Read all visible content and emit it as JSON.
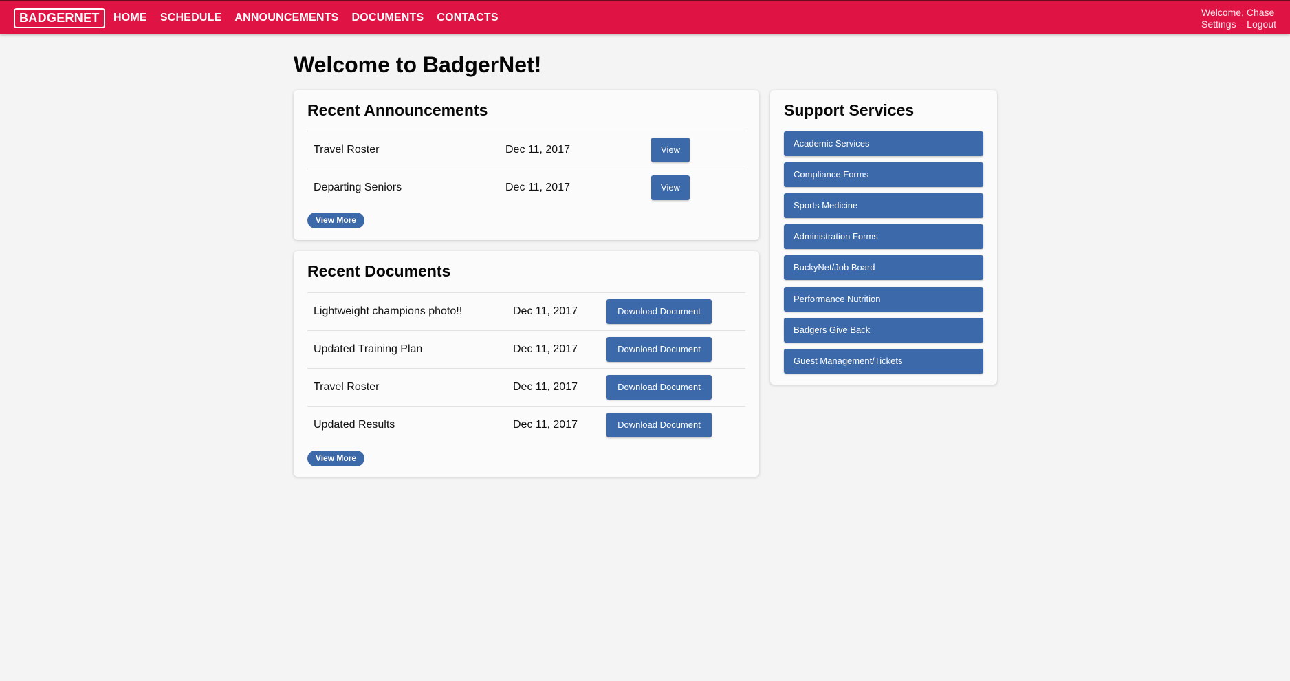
{
  "header": {
    "brand": "BADGERNET",
    "nav": [
      "HOME",
      "SCHEDULE",
      "ANNOUNCEMENTS",
      "DOCUMENTS",
      "CONTACTS"
    ],
    "welcome": "Welcome, Chase",
    "settings": "Settings",
    "separator": "–",
    "logout": "Logout"
  },
  "page": {
    "title": "Welcome to BadgerNet!"
  },
  "announcements": {
    "title": "Recent Announcements",
    "rows": [
      {
        "name": "Travel Roster",
        "date": "Dec 11, 2017",
        "action": "View"
      },
      {
        "name": "Departing Seniors",
        "date": "Dec 11, 2017",
        "action": "View"
      }
    ],
    "more": "View More"
  },
  "documents": {
    "title": "Recent Documents",
    "rows": [
      {
        "name": "Lightweight champions photo!!",
        "date": "Dec 11, 2017",
        "action": "Download Document"
      },
      {
        "name": "Updated Training Plan",
        "date": "Dec 11, 2017",
        "action": "Download Document"
      },
      {
        "name": "Travel Roster",
        "date": "Dec 11, 2017",
        "action": "Download Document"
      },
      {
        "name": "Updated Results",
        "date": "Dec 11, 2017",
        "action": "Download Document"
      }
    ],
    "more": "View More"
  },
  "support": {
    "title": "Support Services",
    "items": [
      "Academic Services",
      "Compliance Forms",
      "Sports Medicine",
      "Administration Forms",
      "BuckyNet/Job Board",
      "Performance Nutrition",
      "Badgers Give Back",
      "Guest Management/Tickets"
    ]
  },
  "colors": {
    "header": "#e01444",
    "button": "#3c69a9",
    "background": "#f4f4f4"
  }
}
